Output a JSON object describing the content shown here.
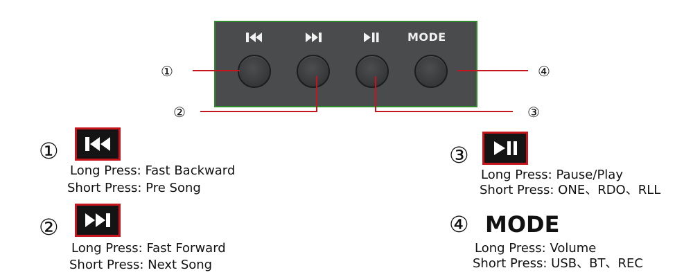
{
  "panel": {
    "mode_label": "MODE",
    "icons": [
      "previous-icon",
      "next-icon",
      "play-pause-icon"
    ],
    "border_color": "#2e8b2e",
    "body_color": "#4a4b4d"
  },
  "callouts": {
    "c1": "①",
    "c2": "②",
    "c3": "③",
    "c4": "④",
    "line_color": "#c4161c"
  },
  "legend": {
    "item1": {
      "number": "①",
      "icon": "previous-icon",
      "long_press": "Long Press: Fast Backward",
      "short_press": "Short Press: Pre Song"
    },
    "item2": {
      "number": "②",
      "icon": "next-icon",
      "long_press": "Long Press: Fast Forward",
      "short_press": "Short Press: Next Song"
    },
    "item3": {
      "number": "③",
      "icon": "play-pause-icon",
      "long_press": "Long Press: Pause/Play",
      "short_press": "Short Press: ONE、RDO、RLL"
    },
    "item4": {
      "number": "④",
      "title": "MODE",
      "long_press": "Long Press: Volume",
      "short_press": "Short Press: USB、BT、REC"
    }
  }
}
